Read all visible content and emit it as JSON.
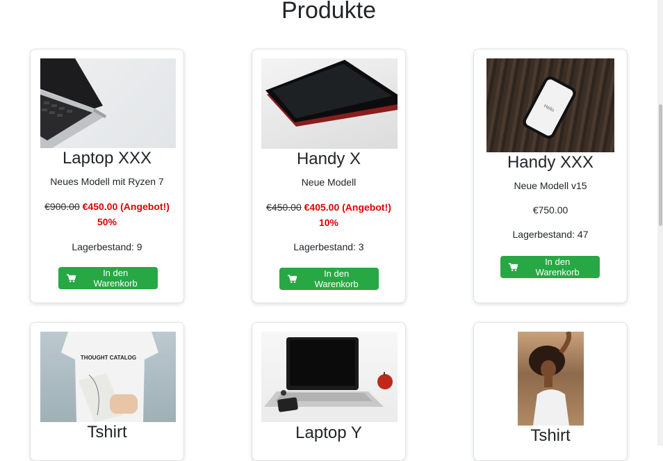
{
  "page": {
    "title": "Produkte"
  },
  "products": [
    {
      "name": "Laptop XXX",
      "description": "Neues Modell mit Ryzen 7",
      "old_price": "€900.00",
      "price": "€450.00 (Angebot!)",
      "discount": "50%",
      "stock": "Lagerbestand: 9",
      "button": "In den Warenkorb"
    },
    {
      "name": "Handy X",
      "description": "Neue Modell",
      "old_price": "€450.00",
      "price": "€405.00 (Angebot!)",
      "discount": "10%",
      "stock": "Lagerbestand: 3",
      "button": "In den Warenkorb"
    },
    {
      "name": "Handy XXX",
      "description": "Neue Modell v15",
      "price": "€750.00",
      "stock": "Lagerbestand: 47",
      "button": "In den Warenkorb"
    },
    {
      "name": "Tshirt"
    },
    {
      "name": "Laptop Y"
    },
    {
      "name": "Tshirt"
    }
  ],
  "image_text": {
    "phone_screen": "Hello",
    "shirt_print": "THOUGHT CATALOG"
  },
  "colors": {
    "sale": "#e00000",
    "button": "#28a745"
  }
}
